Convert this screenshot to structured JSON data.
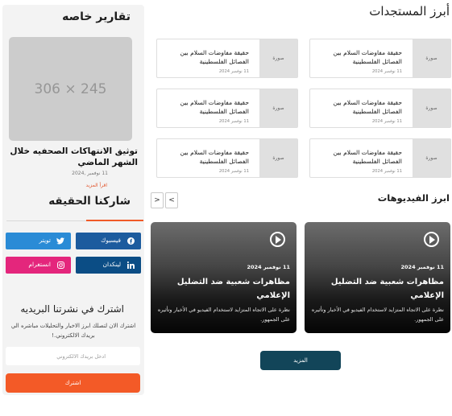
{
  "sidebar": {
    "reports_title": "تقارير خاصه",
    "image_placeholder": "306 × 245",
    "article_title": "توثيق الانتهاكات الصحفيه خلال الشهر الماضي",
    "article_date": "11 نوفمبر ,2024",
    "read_more": "اقرأ المزيد",
    "share_title": "شاركنا الحقيقه",
    "social": {
      "facebook": "فيسبوك",
      "twitter": "تويتر",
      "linkedin": "لينكدان",
      "instagram": "انستغرام"
    },
    "newsletter": {
      "title": "اشترك في نشرتنا البريديه",
      "description": "اشترك الان لتصلك ابرز الاخبار والتحليلات مباشره الي بريدك الالكتروني.!",
      "email_placeholder": "ادخل بريدك الالكتروني",
      "subscribe_label": "اشترك"
    }
  },
  "main": {
    "latest_title": "أبرز المستجدات",
    "cards": [
      {
        "title": "حقيقة مفاوضات السلام بين الفصائل الفلسطينية",
        "date": "11 نوفمبر 2024",
        "thumb": "صورة"
      },
      {
        "title": "حقيقة مفاوضات السلام بين الفصائل الفلسطينية",
        "date": "11 نوفمبر 2024",
        "thumb": "صورة"
      },
      {
        "title": "حقيقة مفاوضات السلام بين الفصائل الفلسطينية",
        "date": "11 نوفمبر 2024",
        "thumb": "صورة"
      },
      {
        "title": "حقيقة مفاوضات السلام بين الفصائل الفلسطينية",
        "date": "11 نوفمبر 2024",
        "thumb": "صورة"
      },
      {
        "title": "حقيقة مفاوضات السلام بين الفصائل الفلسطينية",
        "date": "11 نوفمبر 2024",
        "thumb": "صورة"
      },
      {
        "title": "حقيقة مفاوضات السلام بين الفصائل الفلسطينية",
        "date": "11 نوفمبر 2024",
        "thumb": "صورة"
      }
    ],
    "videos_title": "ابرز الفيديوهات",
    "videos": [
      {
        "date": "11 نوفمبر 2024",
        "title": "مظاهرات شعبية ضد التضليل الإعلامي",
        "description": "نظرة على الاتجاه المتزايد لاستخدام الفيديو في الأخبار وتأثيره على الجمهور."
      },
      {
        "date": "11 نوفمبر 2024",
        "title": "مظاهرات شعبية ضد التضليل الإعلامي",
        "description": "نظرة على الاتجاه المتزايد لاستخدام الفيديو في الأخبار وتأثيره على الجمهور."
      }
    ],
    "more_label": "المزيد",
    "prev_arrow": "<",
    "next_arrow": ">"
  }
}
